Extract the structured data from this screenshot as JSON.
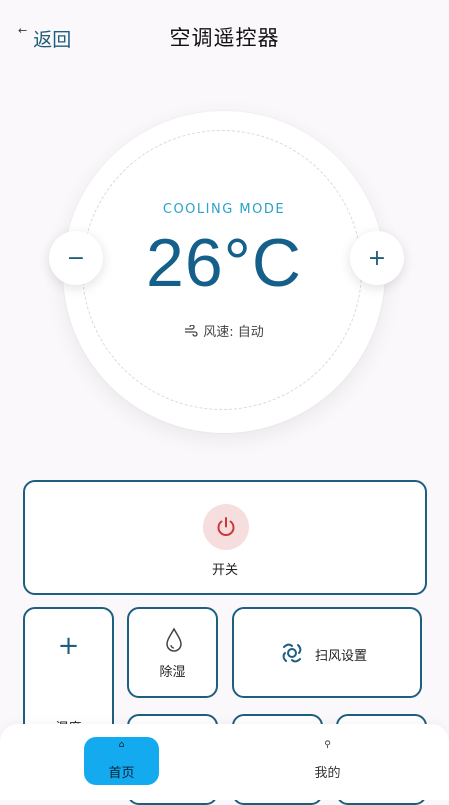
{
  "header": {
    "back_label": "返回",
    "title": "空调遥控器"
  },
  "dial": {
    "mode": "COOLING MODE",
    "temperature": "26°C",
    "fan_label": "风速: 自动",
    "minus_label": "−",
    "plus_label": "+"
  },
  "controls": {
    "power_label": "开关",
    "humidity_label": "湿度",
    "humidity_plus": "+",
    "dehumidify_label": "除湿",
    "swing_label": "扫风设置"
  },
  "nav": {
    "items": [
      {
        "label": "首页",
        "icon": "home-icon",
        "active": true
      },
      {
        "label": "我的",
        "icon": "person-icon",
        "active": false
      }
    ]
  },
  "colors": {
    "accent": "#1d5f7f",
    "mode_text": "#2ba2c7",
    "power_icon": "#c83a3a",
    "nav_active": "#13aaf0"
  }
}
